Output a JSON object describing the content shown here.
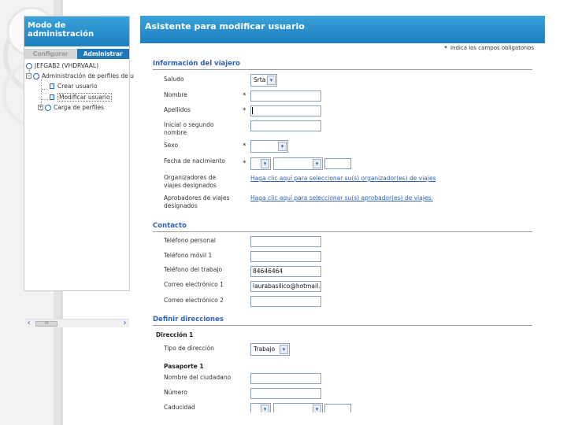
{
  "left_pane": {
    "title": "Modo de administración",
    "tabs": [
      "Configurar",
      "Administrar"
    ],
    "tree": {
      "root": "JEFGAB2 (VHDRVAAL)",
      "admin": "Administración de perfiles de u",
      "crear": "Crear usuario",
      "modificar": "Modificar usuario",
      "carga": "Carga de perfiles"
    },
    "scroll_left": "‹",
    "scroll_right": "›",
    "thumb": "III"
  },
  "header": {
    "title": "Asistente para modificar usuario"
  },
  "required_note": {
    "star": "*",
    "text": "Indica los campos obligatorios"
  },
  "sections": {
    "viajero": "Información del viajero",
    "contacto": "Contacto",
    "direcciones": "Definir direcciones"
  },
  "viajero": {
    "saludo_label": "Saludo",
    "saludo_value": "Srta",
    "nombre_label": "Nombre",
    "nombre_value": "",
    "apellidos_label": "Apellidos",
    "apellidos_value": "",
    "inicial_label_1": "Inicial o segundo",
    "inicial_label_2": "nombre",
    "inicial_value": "",
    "sexo_label": "Sexo",
    "sexo_value": "",
    "fecha_label": "Fecha de nacimiento",
    "organizadores_label_1": "Organizadores de",
    "organizadores_label_2": "viajes designados",
    "organizadores_link": "Haga clic aquí para seleccionar su(s) organizador(es) de viajes",
    "aprobadores_label_1": "Aprobadores de viajes",
    "aprobadores_label_2": "designados",
    "aprobadores_link": "Haga clic aquí para seleccionar su(s) aprobador(es) de viajes."
  },
  "contacto": {
    "tel_personal_label": "Teléfono personal",
    "tel_personal_value": "",
    "tel_movil_label": "Teléfono móvil 1",
    "tel_movil_value": "",
    "tel_trabajo_label": "Teléfono del trabajo",
    "tel_trabajo_value": "84646464",
    "correo1_label": "Correo electrónico 1",
    "correo1_value": "laurabasilico@hotmail.com",
    "correo2_label": "Correo electrónico 2",
    "correo2_value": ""
  },
  "direcciones": {
    "direccion_title": "Dirección 1",
    "tipo_label": "Tipo de dirección",
    "tipo_value": "Trabajo",
    "pasaporte_title": "Pasaporte 1",
    "ciudadano_label": "Nombre del ciudadano",
    "ciudadano_value": "",
    "numero_label": "Número",
    "numero_value": "",
    "caducidad_label": "Caducidad"
  },
  "icons": {
    "dropdown": "▾",
    "plus": "+",
    "minus": "−"
  },
  "colors": {
    "header_blue": "#1c7fc0",
    "link_blue": "#2e62b3",
    "tab_active": "#1f78b8"
  }
}
